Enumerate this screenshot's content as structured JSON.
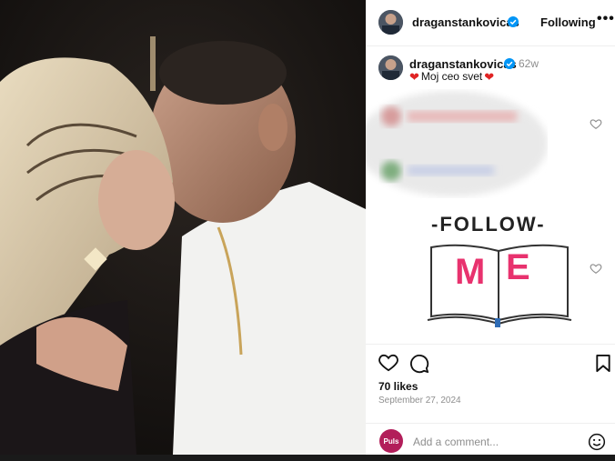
{
  "post": {
    "username": "draganstankovicas",
    "follow_label": "Following",
    "more_label": "•••",
    "time_ago": "62w",
    "caption_text": "Moj ceo svet",
    "sticker_follow": "-FOLLOW-",
    "sticker_m": "M",
    "sticker_e": "E",
    "likes": "70 likes",
    "date": "September 27, 2024",
    "comment_placeholder": "Add a comment...",
    "profile_badge": "Puls"
  },
  "colors": {
    "brand_blue": "#0095f6",
    "heart_red": "#e02424",
    "sticker_pink": "#e8326e",
    "puls_badge": "#b21e5a"
  },
  "icons": [
    "verified-badge-icon",
    "heart-icon",
    "comment-icon",
    "bookmark-icon",
    "emoji-icon",
    "more-icon"
  ]
}
